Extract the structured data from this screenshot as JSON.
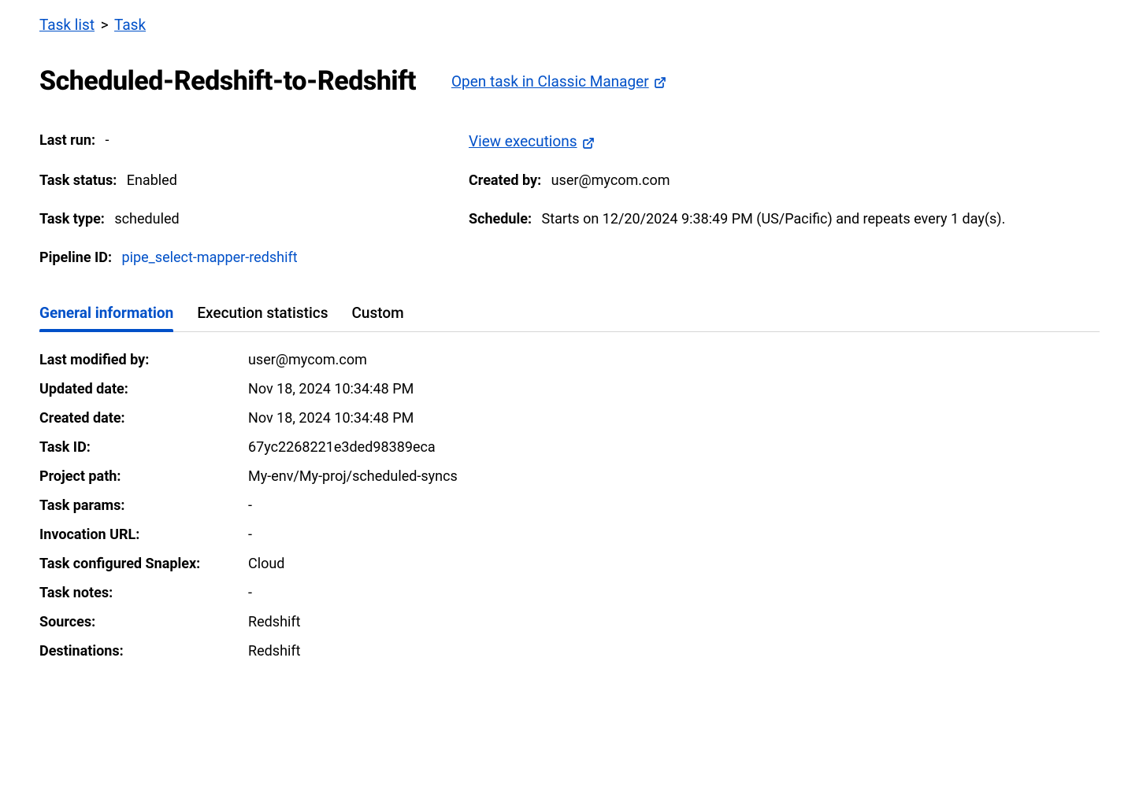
{
  "breadcrumb": {
    "task_list": "Task list",
    "task": "Task"
  },
  "header": {
    "title": "Scheduled-Redshift-to-Redshift",
    "open_classic": "Open task in Classic Manager"
  },
  "summary": {
    "last_run_label": "Last run:",
    "last_run_value": "-",
    "view_executions": "View executions",
    "task_status_label": "Task status:",
    "task_status_value": "Enabled",
    "created_by_label": "Created by:",
    "created_by_value": "user@mycom.com",
    "task_type_label": "Task type:",
    "task_type_value": "scheduled",
    "schedule_label": "Schedule:",
    "schedule_value": "Starts on 12/20/2024 9:38:49 PM (US/Pacific) and repeats every 1 day(s).",
    "pipeline_id_label": "Pipeline ID:",
    "pipeline_id_value": "pipe_select-mapper-redshift"
  },
  "tabs": {
    "general": "General information",
    "exec_stats": "Execution statistics",
    "custom": "Custom"
  },
  "details": {
    "last_modified_by_label": "Last modified by:",
    "last_modified_by_value": "user@mycom.com",
    "updated_date_label": "Updated date:",
    "updated_date_value": "Nov 18, 2024 10:34:48 PM",
    "created_date_label": "Created date:",
    "created_date_value": "Nov 18, 2024 10:34:48 PM",
    "task_id_label": "Task ID:",
    "task_id_value": "67yc2268221e3ded98389eca",
    "project_path_label": "Project path:",
    "project_path_value": "My-env/My-proj/scheduled-syncs",
    "task_params_label": "Task params:",
    "task_params_value": "-",
    "invocation_url_label": "Invocation URL:",
    "invocation_url_value": "-",
    "snaplex_label": "Task configured Snaplex:",
    "snaplex_value": "Cloud",
    "task_notes_label": "Task notes:",
    "task_notes_value": "-",
    "sources_label": "Sources:",
    "sources_value": "Redshift",
    "destinations_label": "Destinations:",
    "destinations_value": "Redshift"
  }
}
